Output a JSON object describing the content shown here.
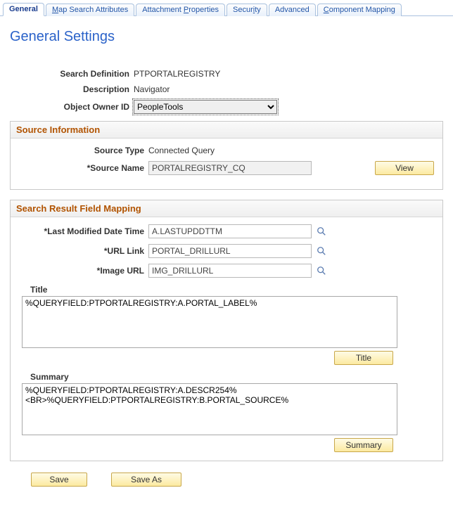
{
  "tabs": {
    "general": "General",
    "map_pre": "M",
    "map_post": "ap Search Attributes",
    "attach_pre": "Attachment ",
    "attach_u": "P",
    "attach_post": "roperties",
    "security_pre": "Secur",
    "security_u": "i",
    "security_post": "ty",
    "advanced": "Advanced",
    "component_pre": "C",
    "component_post": "omponent Mapping"
  },
  "page": {
    "title": "General Settings"
  },
  "def": {
    "search_def_label": "Search Definition",
    "search_def_value": "PTPORTALREGISTRY",
    "description_label": "Description",
    "description_value": "Navigator",
    "owner_label": "Object Owner ID",
    "owner_value": "PeopleTools"
  },
  "source": {
    "group_title": "Source Information",
    "type_label": "Source Type",
    "type_value": "Connected Query",
    "name_label": "Source Name",
    "name_value": "PORTALREGISTRY_CQ",
    "view_btn": "View"
  },
  "srfm": {
    "group_title": "Search Result Field Mapping",
    "lmdt_label": "Last Modified Date Time",
    "lmdt_value": "A.LASTUPDDTTM",
    "url_label": "URL Link",
    "url_value": "PORTAL_DRILLURL",
    "img_label": "Image URL",
    "img_value": "IMG_DRILLURL",
    "title_label": "Title",
    "title_value": "%QUERYFIELD:PTPORTALREGISTRY:A.PORTAL_LABEL%",
    "title_btn": "Title",
    "summary_label": "Summary",
    "summary_value": "%QUERYFIELD:PTPORTALREGISTRY:A.DESCR254%\n<BR>%QUERYFIELD:PTPORTALREGISTRY:B.PORTAL_SOURCE%",
    "summary_btn": "Summary"
  },
  "footer": {
    "save": "Save",
    "save_as": "Save As"
  }
}
